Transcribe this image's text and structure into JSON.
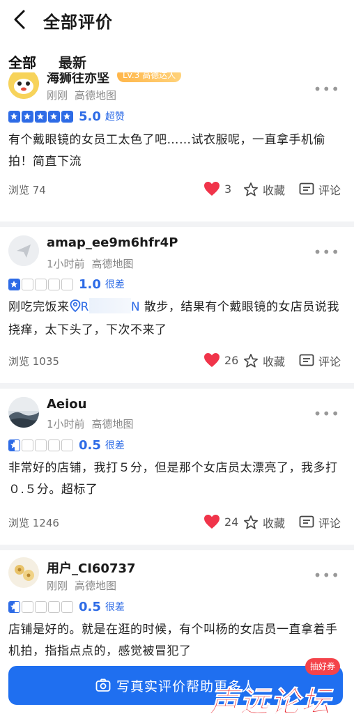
{
  "header": {
    "title": "全部评价"
  },
  "tabs": [
    {
      "label": "全部"
    },
    {
      "label": "最新"
    }
  ],
  "reviews": [
    {
      "username": "海狮往亦坚",
      "badge": "Lv.3 高德达人",
      "time": "刚刚",
      "source": "高德地图",
      "rating": 5,
      "score": "5.0",
      "score_label": "超赞",
      "content": "有个戴眼镜的女员工太色了吧……试衣服呢，一直拿手机偷拍！简直下流",
      "views": "浏览 74",
      "likes": "3",
      "favorite_label": "收藏",
      "comment_label": "评论"
    },
    {
      "username": "amap_ee9m6hfr4P",
      "time": "1小时前",
      "source": "高德地图",
      "rating": 1,
      "score": "1.0",
      "score_label": "很差",
      "content_prefix": "刚吃完饭来",
      "location_start": "R",
      "location_end": "N",
      "content_suffix": " 散步，结果有个戴眼镜的女店员说我挠痒，太下头了，下次不来了",
      "views": "浏览 1035",
      "likes": "26",
      "favorite_label": "收藏",
      "comment_label": "评论"
    },
    {
      "username": "Aeiou",
      "time": "1小时前",
      "source": "高德地图",
      "rating": 0.5,
      "score": "0.5",
      "score_label": "很差",
      "content": "非常好的店铺，我打５分，但是那个女店员太漂亮了，我多打０.５分。超标了",
      "views": "浏览 1246",
      "likes": "24",
      "favorite_label": "收藏",
      "comment_label": "评论"
    },
    {
      "username": "用户_CI60737",
      "time": "刚刚",
      "source": "高德地图",
      "rating": 0.5,
      "score": "0.5",
      "score_label": "很差",
      "content": "店铺是好的。就是在逛的时候，有个叫杨的女店员一直拿着手机拍，指指点点的，感觉被冒犯了"
    }
  ],
  "cta": {
    "label": "写真实评价帮助更多人",
    "badge": "抽好券"
  },
  "watermark": "声远论坛",
  "colors": {
    "accent": "#2d6be6",
    "like": "#f0344a",
    "cta": "#1f6ff0"
  }
}
